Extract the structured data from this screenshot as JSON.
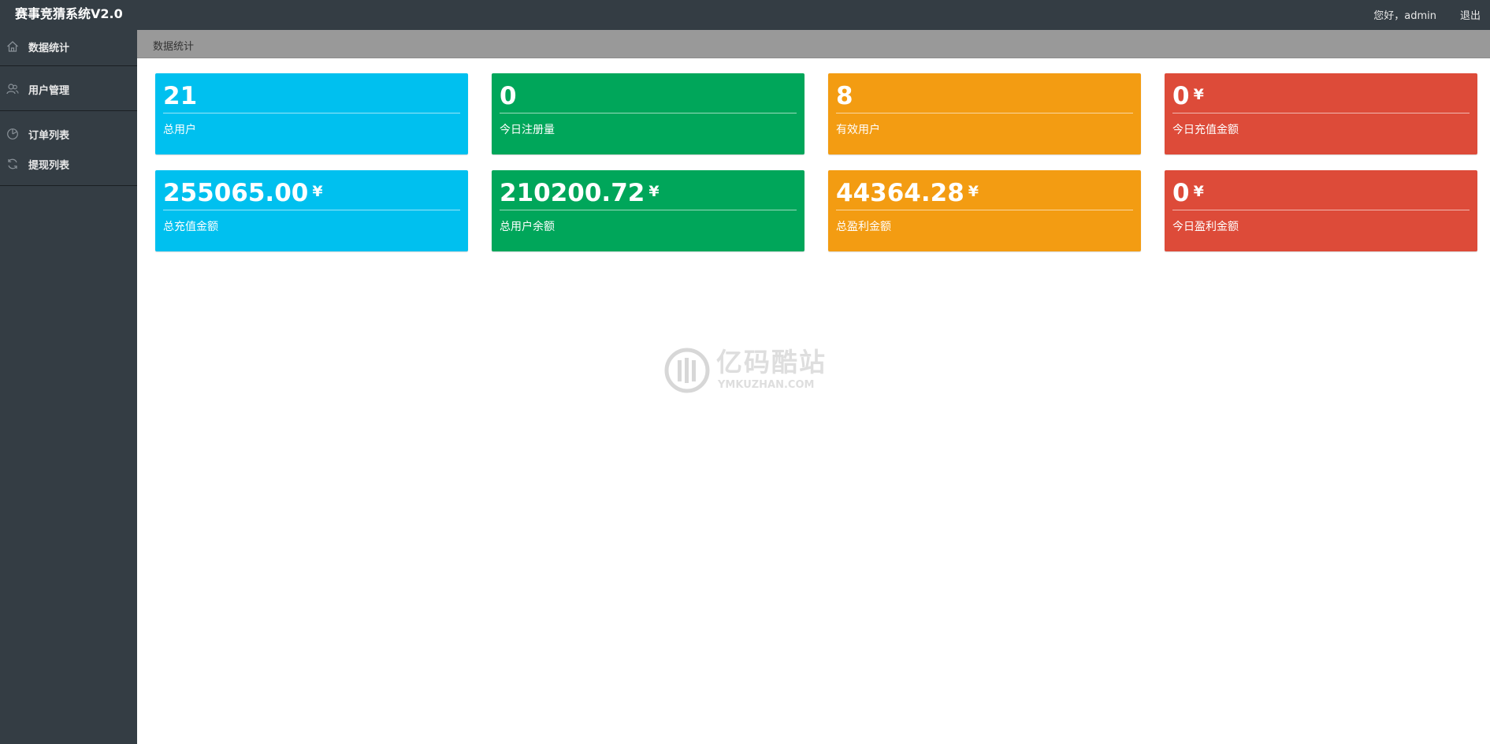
{
  "header": {
    "app_title": "赛事竞猜系统V2.0",
    "greeting": "您好，admin",
    "logout_label": "退出",
    "background_color": "#343d44"
  },
  "sidebar": {
    "items": [
      {
        "label": "数据统计",
        "icon": "home-icon"
      },
      {
        "label": "用户管理",
        "icon": "users-icon"
      },
      {
        "label": "订单列表",
        "icon": "pie-chart-icon"
      },
      {
        "label": "提现列表",
        "icon": "refresh-icon"
      }
    ]
  },
  "breadcrumb": {
    "current": "数据统计"
  },
  "cards": [
    {
      "value": "21",
      "unit": "",
      "label": "总用户",
      "color": "#00c0ef"
    },
    {
      "value": "0",
      "unit": "",
      "label": "今日注册量",
      "color": "#00a65a"
    },
    {
      "value": "8",
      "unit": "",
      "label": "有效用户",
      "color": "#f39c12"
    },
    {
      "value": "0",
      "unit": "¥",
      "label": "今日充值金额",
      "color": "#dd4b39"
    },
    {
      "value": "255065.00",
      "unit": "¥",
      "label": "总充值金额",
      "color": "#00c0ef"
    },
    {
      "value": "210200.72",
      "unit": "¥",
      "label": "总用户余额",
      "color": "#00a65a"
    },
    {
      "value": "44364.28",
      "unit": "¥",
      "label": "总盈利金额",
      "color": "#f39c12"
    },
    {
      "value": "0",
      "unit": "¥",
      "label": "今日盈利金额",
      "color": "#dd4b39"
    }
  ],
  "watermark": {
    "cn_text": "亿码酷站",
    "en_text": "YMKUZHAN.COM"
  }
}
